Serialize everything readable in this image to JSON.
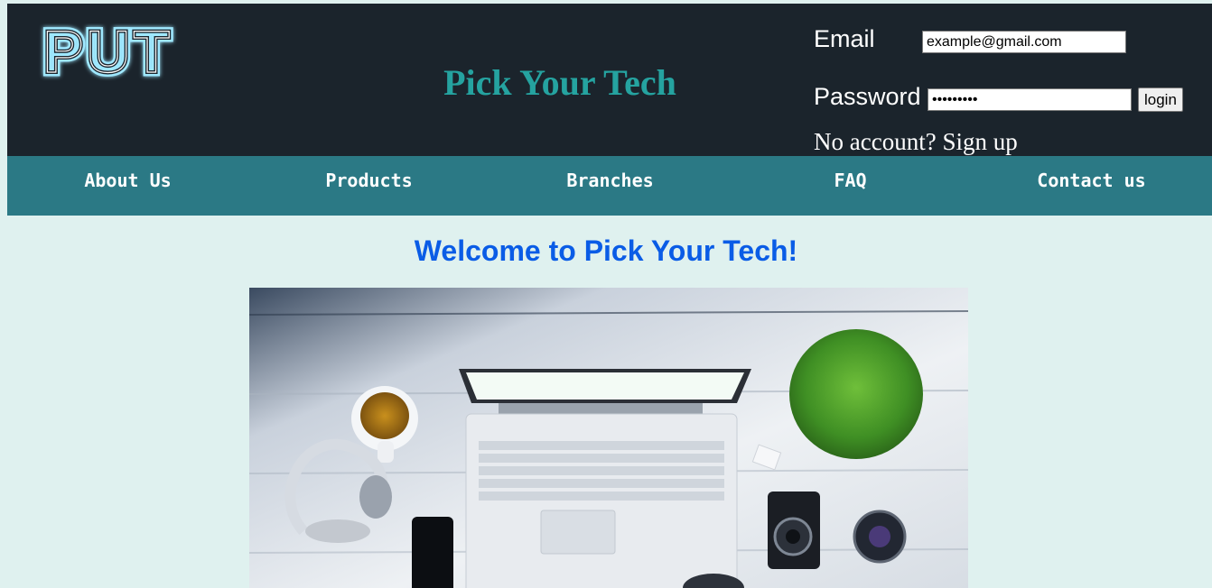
{
  "header": {
    "logo_text": "PUT",
    "site_title": "Pick Your Tech"
  },
  "login": {
    "email_label": "Email",
    "email_value": "example@gmail.com",
    "password_label": "Password",
    "password_value": "password1",
    "login_label": "login",
    "no_account_text": "No account?",
    "signup_label": "Sign up"
  },
  "nav": {
    "items": [
      {
        "label": "About Us"
      },
      {
        "label": "Products"
      },
      {
        "label": "Branches"
      },
      {
        "label": "FAQ"
      },
      {
        "label": "Contact us"
      }
    ]
  },
  "main": {
    "welcome_heading": "Welcome to Pick Your Tech!"
  },
  "colors": {
    "header_bg": "#1b242c",
    "nav_bg": "#2b7985",
    "page_bg": "#dff1ef",
    "title_teal": "#25a3a0",
    "welcome_blue": "#0a5ce6"
  },
  "icons": {
    "logo": "put-neon-logo",
    "hero": "desk-workspace-photo"
  }
}
